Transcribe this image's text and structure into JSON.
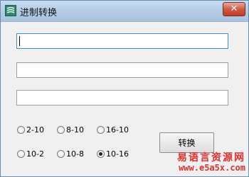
{
  "window": {
    "title": "进制转换",
    "close_symbol": "✕"
  },
  "fields": [
    {
      "value": ""
    },
    {
      "value": ""
    },
    {
      "value": ""
    }
  ],
  "radios": [
    {
      "label": "2-10",
      "checked": false
    },
    {
      "label": "8-10",
      "checked": false
    },
    {
      "label": "16-10",
      "checked": false
    },
    {
      "label": "10-2",
      "checked": false
    },
    {
      "label": "10-8",
      "checked": false
    },
    {
      "label": "10-16",
      "checked": true
    }
  ],
  "convert_button": {
    "label": "转换"
  },
  "watermark": {
    "line1": "易语言资源网",
    "line2": "www.e5a5x.com",
    "color": "#e62d2d"
  }
}
